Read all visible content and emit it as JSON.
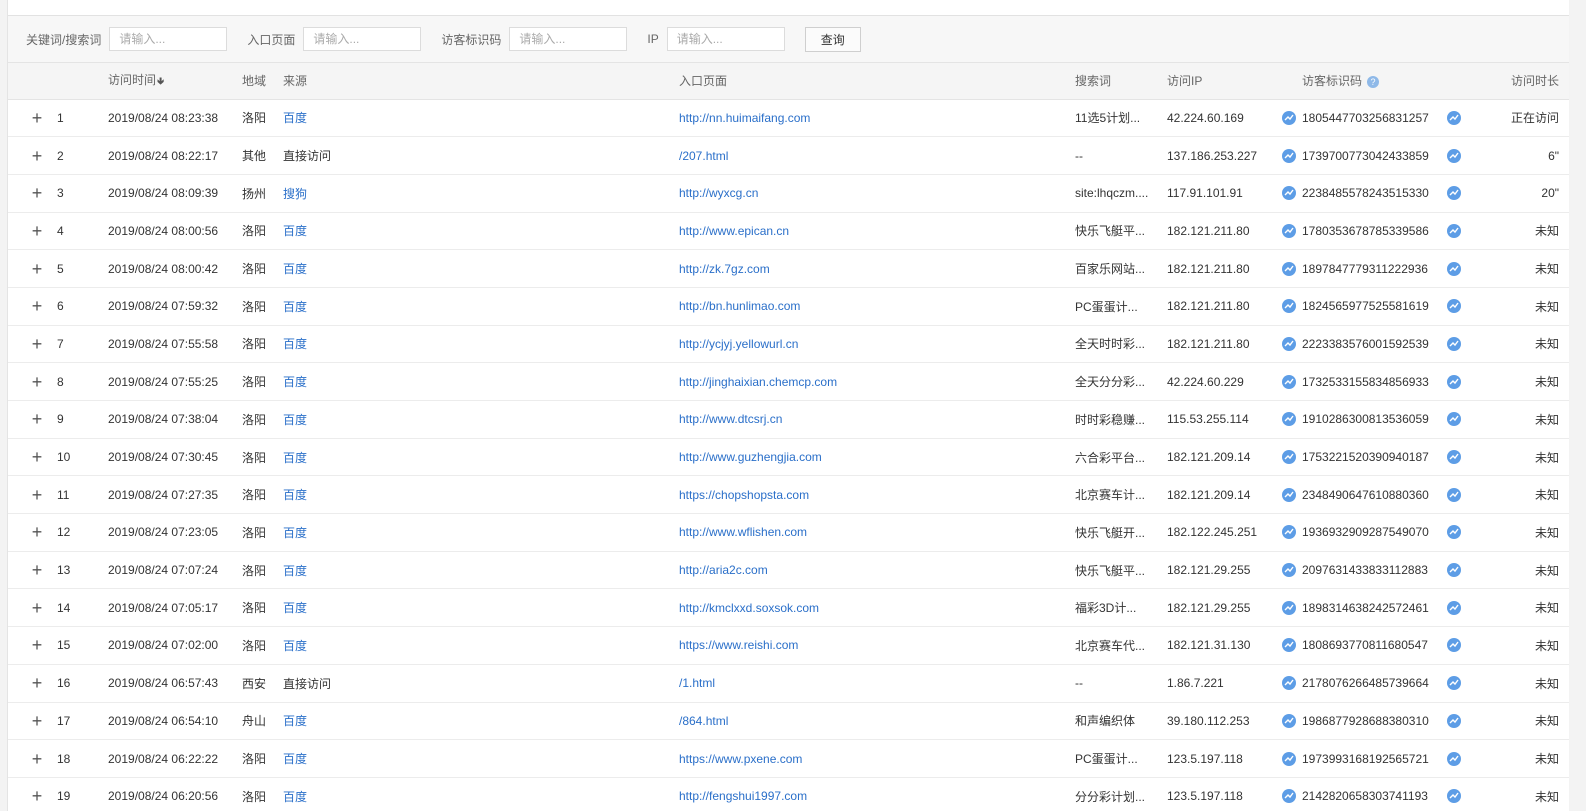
{
  "filters": {
    "keyword_label": "关键词/搜索词",
    "keyword_placeholder": "请输入...",
    "landing_label": "入口页面",
    "landing_placeholder": "请输入...",
    "visitor_label": "访客标识码",
    "visitor_placeholder": "请输入...",
    "ip_label": "IP",
    "ip_placeholder": "请输入...",
    "query_label": "查询"
  },
  "table": {
    "headers": {
      "time": "访问时间",
      "region": "地域",
      "source": "来源",
      "landing": "入口页面",
      "keyword": "搜索词",
      "ip": "访问IP",
      "visitor_id": "访客标识码",
      "duration": "访问时长"
    },
    "rows": [
      {
        "idx": "1",
        "time": "2019/08/24 08:23:38",
        "region": "洛阳",
        "source": "百度",
        "source_link": true,
        "landing": "http://nn.huimaifang.com",
        "keyword": "11选5计划...",
        "ip": "42.224.60.169",
        "visitor_id": "1805447703256831257",
        "duration": "正在访问"
      },
      {
        "idx": "2",
        "time": "2019/08/24 08:22:17",
        "region": "其他",
        "source": "直接访问",
        "source_link": false,
        "landing": "/207.html",
        "keyword": "--",
        "ip": "137.186.253.227",
        "visitor_id": "1739700773042433859",
        "duration": "6\""
      },
      {
        "idx": "3",
        "time": "2019/08/24 08:09:39",
        "region": "扬州",
        "source": "搜狗",
        "source_link": true,
        "landing": "http://wyxcg.cn",
        "keyword": "site:lhqczm....",
        "ip": "117.91.101.91",
        "visitor_id": "2238485578243515330",
        "duration": "20\""
      },
      {
        "idx": "4",
        "time": "2019/08/24 08:00:56",
        "region": "洛阳",
        "source": "百度",
        "source_link": true,
        "landing": "http://www.epican.cn",
        "keyword": "快乐飞艇平...",
        "ip": "182.121.211.80",
        "visitor_id": "1780353678785339586",
        "duration": "未知"
      },
      {
        "idx": "5",
        "time": "2019/08/24 08:00:42",
        "region": "洛阳",
        "source": "百度",
        "source_link": true,
        "landing": "http://zk.7gz.com",
        "keyword": "百家乐网站...",
        "ip": "182.121.211.80",
        "visitor_id": "1897847779311222936",
        "duration": "未知"
      },
      {
        "idx": "6",
        "time": "2019/08/24 07:59:32",
        "region": "洛阳",
        "source": "百度",
        "source_link": true,
        "landing": "http://bn.hunlimao.com",
        "keyword": "PC蛋蛋计...",
        "ip": "182.121.211.80",
        "visitor_id": "1824565977525581619",
        "duration": "未知"
      },
      {
        "idx": "7",
        "time": "2019/08/24 07:55:58",
        "region": "洛阳",
        "source": "百度",
        "source_link": true,
        "landing": "http://ycjyj.yellowurl.cn",
        "keyword": "全天时时彩...",
        "ip": "182.121.211.80",
        "visitor_id": "2223383576001592539",
        "duration": "未知"
      },
      {
        "idx": "8",
        "time": "2019/08/24 07:55:25",
        "region": "洛阳",
        "source": "百度",
        "source_link": true,
        "landing": "http://jinghaixian.chemcp.com",
        "keyword": "全天分分彩...",
        "ip": "42.224.60.229",
        "visitor_id": "1732533155834856933",
        "duration": "未知"
      },
      {
        "idx": "9",
        "time": "2019/08/24 07:38:04",
        "region": "洛阳",
        "source": "百度",
        "source_link": true,
        "landing": "http://www.dtcsrj.cn",
        "keyword": "时时彩稳赚...",
        "ip": "115.53.255.114",
        "visitor_id": "1910286300813536059",
        "duration": "未知"
      },
      {
        "idx": "10",
        "time": "2019/08/24 07:30:45",
        "region": "洛阳",
        "source": "百度",
        "source_link": true,
        "landing": "http://www.guzhengjia.com",
        "keyword": "六合彩平台...",
        "ip": "182.121.209.14",
        "visitor_id": "1753221520390940187",
        "duration": "未知"
      },
      {
        "idx": "11",
        "time": "2019/08/24 07:27:35",
        "region": "洛阳",
        "source": "百度",
        "source_link": true,
        "landing": "https://chopshopsta.com",
        "keyword": "北京赛车计...",
        "ip": "182.121.209.14",
        "visitor_id": "2348490647610880360",
        "duration": "未知"
      },
      {
        "idx": "12",
        "time": "2019/08/24 07:23:05",
        "region": "洛阳",
        "source": "百度",
        "source_link": true,
        "landing": "http://www.wflishen.com",
        "keyword": "快乐飞艇开...",
        "ip": "182.122.245.251",
        "visitor_id": "1936932909287549070",
        "duration": "未知"
      },
      {
        "idx": "13",
        "time": "2019/08/24 07:07:24",
        "region": "洛阳",
        "source": "百度",
        "source_link": true,
        "landing": "http://aria2c.com",
        "keyword": "快乐飞艇平...",
        "ip": "182.121.29.255",
        "visitor_id": "2097631433833112883",
        "duration": "未知"
      },
      {
        "idx": "14",
        "time": "2019/08/24 07:05:17",
        "region": "洛阳",
        "source": "百度",
        "source_link": true,
        "landing": "http://kmclxxd.soxsok.com",
        "keyword": "福彩3D计...",
        "ip": "182.121.29.255",
        "visitor_id": "1898314638242572461",
        "duration": "未知"
      },
      {
        "idx": "15",
        "time": "2019/08/24 07:02:00",
        "region": "洛阳",
        "source": "百度",
        "source_link": true,
        "landing": "https://www.reishi.com",
        "keyword": "北京赛车代...",
        "ip": "182.121.31.130",
        "visitor_id": "1808693770811680547",
        "duration": "未知"
      },
      {
        "idx": "16",
        "time": "2019/08/24 06:57:43",
        "region": "西安",
        "source": "直接访问",
        "source_link": false,
        "landing": "/1.html",
        "keyword": "--",
        "ip": "1.86.7.221",
        "visitor_id": "2178076266485739664",
        "duration": "未知"
      },
      {
        "idx": "17",
        "time": "2019/08/24 06:54:10",
        "region": "舟山",
        "source": "百度",
        "source_link": true,
        "landing": "/864.html",
        "keyword": "和声编织体",
        "ip": "39.180.112.253",
        "visitor_id": "1986877928688380310",
        "duration": "未知"
      },
      {
        "idx": "18",
        "time": "2019/08/24 06:22:22",
        "region": "洛阳",
        "source": "百度",
        "source_link": true,
        "landing": "https://www.pxene.com",
        "keyword": "PC蛋蛋计...",
        "ip": "123.5.197.118",
        "visitor_id": "1973993168192565721",
        "duration": "未知"
      },
      {
        "idx": "19",
        "time": "2019/08/24 06:20:56",
        "region": "洛阳",
        "source": "百度",
        "source_link": true,
        "landing": "http://fengshui1997.com",
        "keyword": "分分彩计划...",
        "ip": "123.5.197.118",
        "visitor_id": "2142820658303741193",
        "duration": "未知"
      }
    ]
  },
  "colors": {
    "link": "#2a6fc9",
    "icon": "#5d9de6"
  },
  "icons": {
    "expand": "plus-icon",
    "sort": "sort-down-icon",
    "help": "help-icon",
    "trend": "trend-chart-icon"
  }
}
